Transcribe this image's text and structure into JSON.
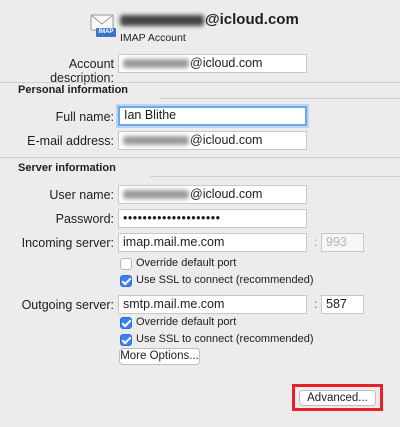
{
  "header": {
    "email_suffix": "@icloud.com",
    "account_type": "IMAP Account",
    "icon_badge": "IMAP"
  },
  "account": {
    "description_label": "Account description:",
    "description_suffix": "@icloud.com"
  },
  "personal": {
    "section_title": "Personal information",
    "full_name_label": "Full name:",
    "full_name_value": "Ian Blithe",
    "email_label": "E-mail address:",
    "email_suffix": "@icloud.com"
  },
  "server": {
    "section_title": "Server information",
    "username_label": "User name:",
    "username_suffix": "@icloud.com",
    "password_label": "Password:",
    "password_value": "••••••••••••••••••••",
    "incoming_label": "Incoming server:",
    "incoming_value": "imap.mail.me.com",
    "incoming_port_placeholder": "993",
    "incoming_override_label": "Override default port",
    "incoming_override_checked": false,
    "incoming_ssl_label": "Use SSL to connect (recommended)",
    "incoming_ssl_checked": true,
    "outgoing_label": "Outgoing server:",
    "outgoing_value": "smtp.mail.me.com",
    "outgoing_port": "587",
    "outgoing_override_label": "Override default port",
    "outgoing_override_checked": true,
    "outgoing_ssl_label": "Use SSL to connect (recommended)",
    "outgoing_ssl_checked": true,
    "more_options_label": "More Options..."
  },
  "footer": {
    "advanced_label": "Advanced...",
    "highlight_color": "#e8202a"
  }
}
